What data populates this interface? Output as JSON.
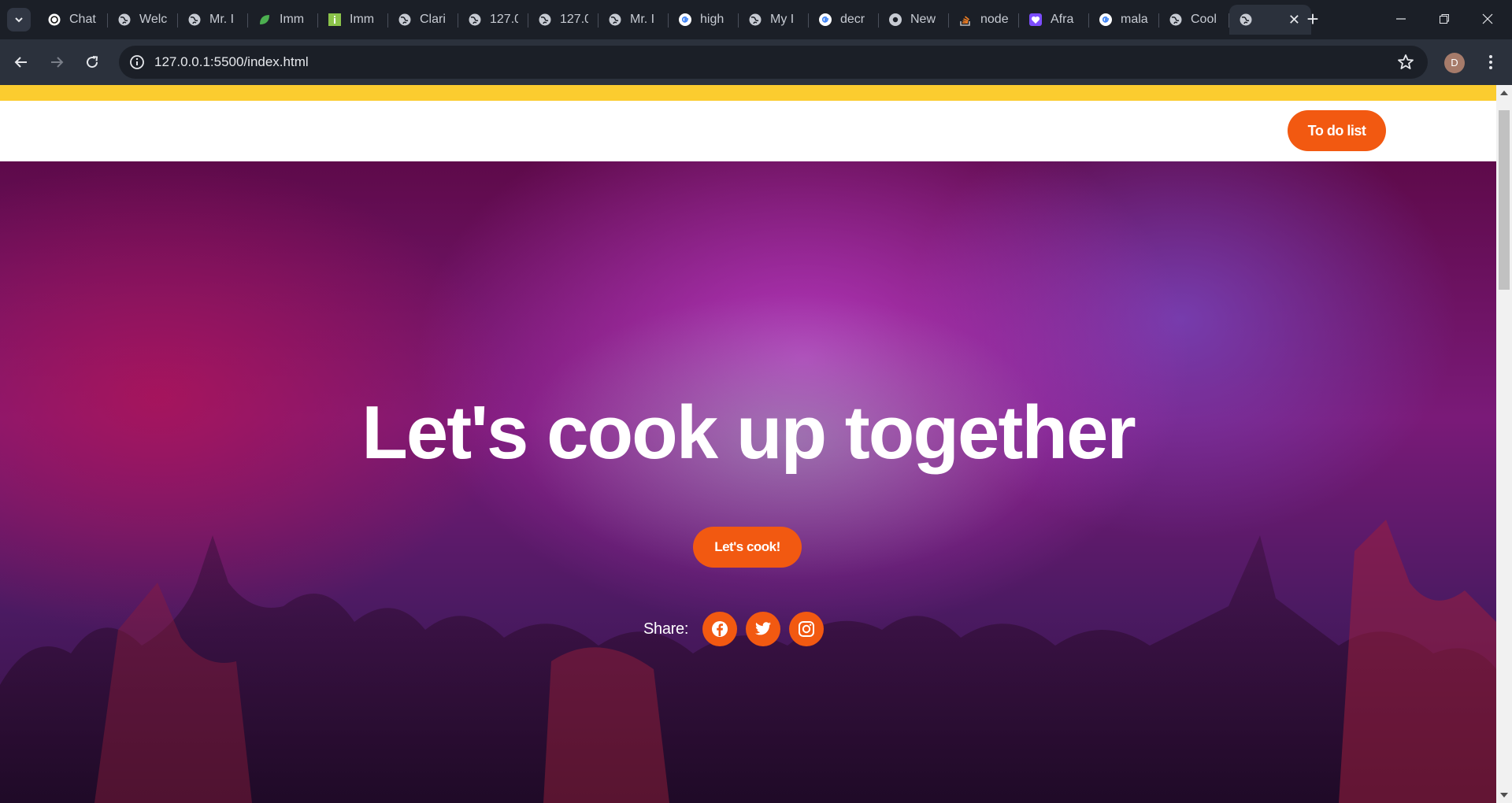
{
  "browser": {
    "tabs": [
      {
        "title": "Chat",
        "icon": "chatgpt-icon"
      },
      {
        "title": "Welc",
        "icon": "globe-icon"
      },
      {
        "title": "Mr. I",
        "icon": "globe-icon"
      },
      {
        "title": "Imm",
        "icon": "leaf-icon"
      },
      {
        "title": "Imm",
        "icon": "info-favicon-icon"
      },
      {
        "title": "Clari",
        "icon": "globe-icon"
      },
      {
        "title": "127.0",
        "icon": "globe-icon"
      },
      {
        "title": "127.0",
        "icon": "globe-icon"
      },
      {
        "title": "Mr. I",
        "icon": "globe-icon"
      },
      {
        "title": "high",
        "icon": "google-icon"
      },
      {
        "title": "My I",
        "icon": "globe-icon"
      },
      {
        "title": "decr",
        "icon": "google-icon"
      },
      {
        "title": "New",
        "icon": "chrome-icon"
      },
      {
        "title": "node",
        "icon": "stackoverflow-icon"
      },
      {
        "title": "Afra",
        "icon": "heart-icon"
      },
      {
        "title": "mala",
        "icon": "google-icon"
      },
      {
        "title": "Cool",
        "icon": "globe-icon"
      }
    ],
    "active_tab_icon": "globe-icon",
    "url": "127.0.0.1:5500/index.html",
    "profile_initial": "D"
  },
  "site": {
    "todo_button": "To do list",
    "hero_title": "Let's cook up together",
    "cook_button": "Let's cook!",
    "share_label": "Share:",
    "social": [
      "facebook-icon",
      "twitter-icon",
      "instagram-icon"
    ]
  },
  "colors": {
    "accent_orange": "#f25911",
    "top_bar_yellow": "#fbcc2f"
  }
}
